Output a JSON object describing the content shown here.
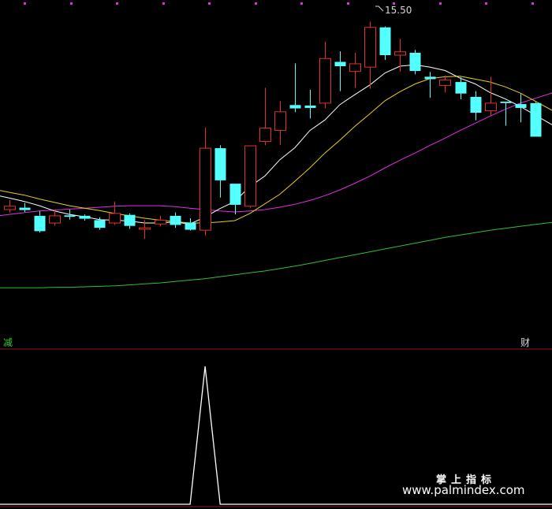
{
  "price_panel": {
    "max_label": "15.50"
  },
  "indicator_panel": {
    "left_tag": "减",
    "right_tag": "财"
  },
  "watermark": {
    "line1": "掌上指标",
    "line2": "www.palmindex.com"
  },
  "colors": {
    "up": "#e03030",
    "down": "#54ffff",
    "ma5": "#ffffff",
    "ma10": "#e8d020",
    "ma20": "#e030e0",
    "ma60": "#30c030",
    "signal": "#ffffff",
    "divider": "#8b1a1a"
  },
  "chart_data": {
    "type": "candlestick",
    "price_range": [
      10.2,
      15.72
    ],
    "candles": [
      {
        "o": 11.58,
        "c": 11.65,
        "h": 11.78,
        "l": 11.52
      },
      {
        "o": 11.62,
        "c": 11.57,
        "h": 11.72,
        "l": 11.53
      },
      {
        "o": 11.45,
        "c": 11.13,
        "h": 11.55,
        "l": 11.1
      },
      {
        "o": 11.3,
        "c": 11.45,
        "h": 11.58,
        "l": 11.25
      },
      {
        "o": 11.46,
        "c": 11.43,
        "h": 11.58,
        "l": 11.37
      },
      {
        "o": 11.45,
        "c": 11.39,
        "h": 11.48,
        "l": 11.35
      },
      {
        "o": 11.36,
        "c": 11.2,
        "h": 11.42,
        "l": 11.16
      },
      {
        "o": 11.3,
        "c": 11.5,
        "h": 11.75,
        "l": 11.26
      },
      {
        "o": 11.47,
        "c": 11.24,
        "h": 11.5,
        "l": 11.18
      },
      {
        "o": 11.17,
        "c": 11.2,
        "h": 11.36,
        "l": 10.97
      },
      {
        "o": 11.28,
        "c": 11.36,
        "h": 11.45,
        "l": 11.23
      },
      {
        "o": 11.45,
        "c": 11.26,
        "h": 11.52,
        "l": 11.2
      },
      {
        "o": 11.31,
        "c": 11.16,
        "h": 11.4,
        "l": 11.14
      },
      {
        "o": 11.15,
        "c": 12.86,
        "h": 13.29,
        "l": 11.04
      },
      {
        "o": 12.86,
        "c": 12.19,
        "h": 12.92,
        "l": 11.83
      },
      {
        "o": 12.12,
        "c": 11.68,
        "h": 12.12,
        "l": 11.48
      },
      {
        "o": 11.65,
        "c": 12.91,
        "h": 12.91,
        "l": 11.62
      },
      {
        "o": 13.0,
        "c": 13.28,
        "h": 14.12,
        "l": 12.92
      },
      {
        "o": 13.23,
        "c": 13.62,
        "h": 13.84,
        "l": 12.93
      },
      {
        "o": 13.76,
        "c": 13.69,
        "h": 14.63,
        "l": 13.61
      },
      {
        "o": 13.75,
        "c": 13.7,
        "h": 14.08,
        "l": 13.48
      },
      {
        "o": 13.8,
        "c": 14.73,
        "h": 15.08,
        "l": 13.69
      },
      {
        "o": 14.66,
        "c": 14.57,
        "h": 14.88,
        "l": 14.05
      },
      {
        "o": 14.46,
        "c": 14.62,
        "h": 14.85,
        "l": 14.12
      },
      {
        "o": 14.55,
        "c": 15.38,
        "h": 15.5,
        "l": 14.1
      },
      {
        "o": 15.38,
        "c": 14.8,
        "h": 15.4,
        "l": 14.7
      },
      {
        "o": 14.8,
        "c": 14.87,
        "h": 15.14,
        "l": 14.45
      },
      {
        "o": 14.85,
        "c": 14.47,
        "h": 14.91,
        "l": 14.4
      },
      {
        "o": 14.35,
        "c": 14.3,
        "h": 14.45,
        "l": 13.91
      },
      {
        "o": 14.17,
        "c": 14.28,
        "h": 14.38,
        "l": 14.02
      },
      {
        "o": 14.24,
        "c": 14.0,
        "h": 14.34,
        "l": 13.88
      },
      {
        "o": 13.93,
        "c": 13.6,
        "h": 14.05,
        "l": 13.44
      },
      {
        "o": 13.64,
        "c": 13.8,
        "h": 14.35,
        "l": 13.53
      },
      {
        "o": 13.83,
        "c": 13.8,
        "h": 13.83,
        "l": 13.33
      },
      {
        "o": 13.78,
        "c": 13.7,
        "h": 13.99,
        "l": 13.4
      },
      {
        "o": 13.8,
        "c": 13.1,
        "h": 13.82,
        "l": 13.1
      }
    ],
    "ma5": [
      11.82,
      11.75,
      11.66,
      11.55,
      11.48,
      11.43,
      11.37,
      11.36,
      11.34,
      11.3,
      11.3,
      11.32,
      11.28,
      11.42,
      11.6,
      11.75,
      12.06,
      12.28,
      12.62,
      12.87,
      13.23,
      13.45,
      13.77,
      13.98,
      14.18,
      14.43,
      14.57,
      14.6,
      14.55,
      14.48,
      14.32,
      14.2,
      14.02,
      13.89,
      13.73,
      13.55
    ],
    "ma10": [
      11.94,
      11.88,
      11.8,
      11.73,
      11.66,
      11.61,
      11.56,
      11.5,
      11.45,
      11.4,
      11.36,
      11.33,
      11.3,
      11.3,
      11.32,
      11.35,
      11.5,
      11.7,
      11.9,
      12.17,
      12.45,
      12.76,
      13.03,
      13.32,
      13.58,
      13.85,
      14.04,
      14.2,
      14.31,
      14.35,
      14.36,
      14.3,
      14.24,
      14.14,
      14.01,
      13.84
    ],
    "ma20": [
      11.48,
      11.52,
      11.55,
      11.57,
      11.59,
      11.61,
      11.63,
      11.65,
      11.66,
      11.66,
      11.66,
      11.64,
      11.61,
      11.58,
      11.55,
      11.53,
      11.55,
      11.58,
      11.63,
      11.69,
      11.77,
      11.87,
      11.99,
      12.13,
      12.28,
      12.45,
      12.61,
      12.76,
      12.92,
      13.07,
      13.23,
      13.38,
      13.53,
      13.67,
      13.8,
      13.9
    ],
    "ma60": [
      9.95,
      9.95,
      9.95,
      9.96,
      9.96,
      9.97,
      9.98,
      9.99,
      10.01,
      10.03,
      10.05,
      10.08,
      10.11,
      10.14,
      10.18,
      10.22,
      10.26,
      10.3,
      10.35,
      10.4,
      10.46,
      10.52,
      10.58,
      10.64,
      10.7,
      10.76,
      10.82,
      10.88,
      10.94,
      11.0,
      11.05,
      11.1,
      11.15,
      11.19,
      11.23,
      11.27
    ],
    "signal": [
      0,
      0,
      0,
      0,
      0,
      0,
      0,
      0,
      0,
      0,
      0,
      0,
      0,
      1,
      0,
      0,
      0,
      0,
      0,
      0,
      0,
      0,
      0,
      0,
      0,
      0,
      0,
      0,
      0,
      0,
      0,
      0,
      0,
      0,
      0,
      0
    ],
    "signal_range": [
      0,
      1
    ]
  }
}
